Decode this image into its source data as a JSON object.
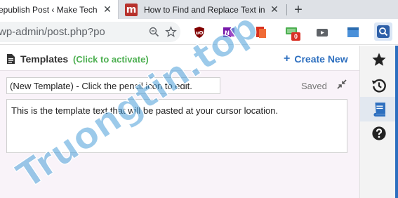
{
  "browser": {
    "tabs": [
      {
        "title": "epublish Post ‹ Make Tech",
        "active": true
      },
      {
        "title": "How to Find and Replace Text in",
        "active": false
      }
    ],
    "url": "wp-admin/post.php?po",
    "extension_badge": "0"
  },
  "panel": {
    "title": "Templates",
    "activate_hint": "(Click to activate)",
    "create_new_label": "Create New",
    "template_name_value": "(New Template) - Click the pencil icon to edit.",
    "status": "Saved",
    "template_text": "This is the template text that will be pasted at your cursor location."
  },
  "sidebar": {
    "items": [
      {
        "icon": "star-icon"
      },
      {
        "icon": "history-icon"
      },
      {
        "icon": "book-icon",
        "active": true
      },
      {
        "icon": "help-icon"
      }
    ]
  },
  "colors": {
    "accent": "#2d6fbf",
    "activate_green": "#4caf50",
    "panel_bg": "#f9f3f9"
  },
  "watermark": {
    "text": "Truongtin.top",
    "color": "#4a9fd8"
  }
}
